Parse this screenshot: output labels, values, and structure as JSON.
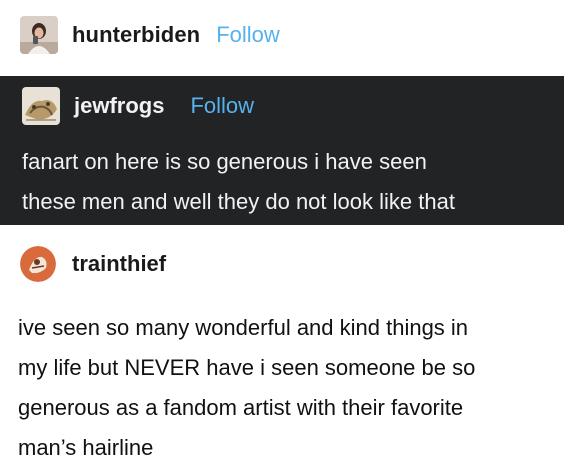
{
  "posts": [
    {
      "username": "hunterbiden",
      "follow_label": "Follow",
      "avatar_icon": "person-photo-avatar"
    },
    {
      "username": "jewfrogs",
      "follow_label": "Follow",
      "avatar_icon": "frog-art-avatar",
      "text_lines": [
        "fanart on here is so generous i have seen",
        "these men and well they do not look like that"
      ],
      "background": "#222325"
    },
    {
      "username": "trainthief",
      "avatar_icon": "orange-circle-avatar",
      "text_lines": [
        "ive seen so many wonderful and kind things in",
        "my life but NEVER have i seen someone be so",
        "generous as a fandom artist with their favorite",
        "man’s hairline"
      ]
    }
  ],
  "colors": {
    "follow": "#56b1ee",
    "dark_block": "#222325",
    "text": "#111111"
  }
}
